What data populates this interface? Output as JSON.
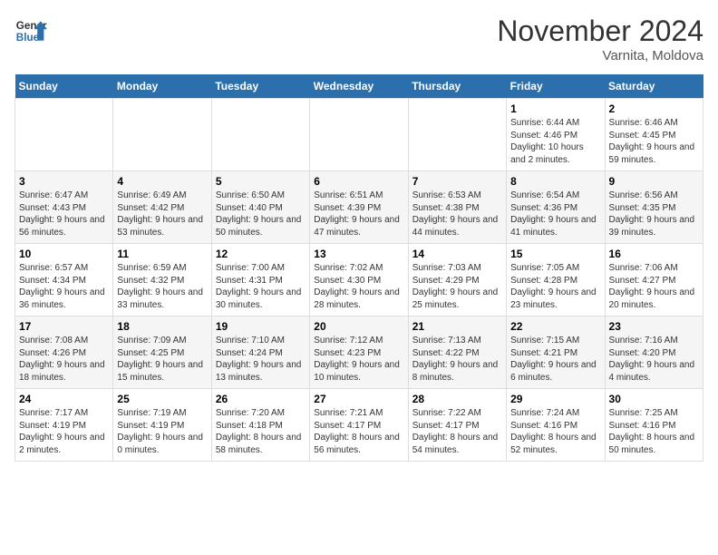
{
  "header": {
    "logo_line1": "General",
    "logo_line2": "Blue",
    "month_title": "November 2024",
    "subtitle": "Varnita, Moldova"
  },
  "days_of_week": [
    "Sunday",
    "Monday",
    "Tuesday",
    "Wednesday",
    "Thursday",
    "Friday",
    "Saturday"
  ],
  "weeks": [
    [
      {
        "day": "",
        "info": ""
      },
      {
        "day": "",
        "info": ""
      },
      {
        "day": "",
        "info": ""
      },
      {
        "day": "",
        "info": ""
      },
      {
        "day": "",
        "info": ""
      },
      {
        "day": "1",
        "info": "Sunrise: 6:44 AM\nSunset: 4:46 PM\nDaylight: 10 hours\nand 2 minutes."
      },
      {
        "day": "2",
        "info": "Sunrise: 6:46 AM\nSunset: 4:45 PM\nDaylight: 9 hours\nand 59 minutes."
      }
    ],
    [
      {
        "day": "3",
        "info": "Sunrise: 6:47 AM\nSunset: 4:43 PM\nDaylight: 9 hours\nand 56 minutes."
      },
      {
        "day": "4",
        "info": "Sunrise: 6:49 AM\nSunset: 4:42 PM\nDaylight: 9 hours\nand 53 minutes."
      },
      {
        "day": "5",
        "info": "Sunrise: 6:50 AM\nSunset: 4:40 PM\nDaylight: 9 hours\nand 50 minutes."
      },
      {
        "day": "6",
        "info": "Sunrise: 6:51 AM\nSunset: 4:39 PM\nDaylight: 9 hours\nand 47 minutes."
      },
      {
        "day": "7",
        "info": "Sunrise: 6:53 AM\nSunset: 4:38 PM\nDaylight: 9 hours\nand 44 minutes."
      },
      {
        "day": "8",
        "info": "Sunrise: 6:54 AM\nSunset: 4:36 PM\nDaylight: 9 hours\nand 41 minutes."
      },
      {
        "day": "9",
        "info": "Sunrise: 6:56 AM\nSunset: 4:35 PM\nDaylight: 9 hours\nand 39 minutes."
      }
    ],
    [
      {
        "day": "10",
        "info": "Sunrise: 6:57 AM\nSunset: 4:34 PM\nDaylight: 9 hours\nand 36 minutes."
      },
      {
        "day": "11",
        "info": "Sunrise: 6:59 AM\nSunset: 4:32 PM\nDaylight: 9 hours\nand 33 minutes."
      },
      {
        "day": "12",
        "info": "Sunrise: 7:00 AM\nSunset: 4:31 PM\nDaylight: 9 hours\nand 30 minutes."
      },
      {
        "day": "13",
        "info": "Sunrise: 7:02 AM\nSunset: 4:30 PM\nDaylight: 9 hours\nand 28 minutes."
      },
      {
        "day": "14",
        "info": "Sunrise: 7:03 AM\nSunset: 4:29 PM\nDaylight: 9 hours\nand 25 minutes."
      },
      {
        "day": "15",
        "info": "Sunrise: 7:05 AM\nSunset: 4:28 PM\nDaylight: 9 hours\nand 23 minutes."
      },
      {
        "day": "16",
        "info": "Sunrise: 7:06 AM\nSunset: 4:27 PM\nDaylight: 9 hours\nand 20 minutes."
      }
    ],
    [
      {
        "day": "17",
        "info": "Sunrise: 7:08 AM\nSunset: 4:26 PM\nDaylight: 9 hours\nand 18 minutes."
      },
      {
        "day": "18",
        "info": "Sunrise: 7:09 AM\nSunset: 4:25 PM\nDaylight: 9 hours\nand 15 minutes."
      },
      {
        "day": "19",
        "info": "Sunrise: 7:10 AM\nSunset: 4:24 PM\nDaylight: 9 hours\nand 13 minutes."
      },
      {
        "day": "20",
        "info": "Sunrise: 7:12 AM\nSunset: 4:23 PM\nDaylight: 9 hours\nand 10 minutes."
      },
      {
        "day": "21",
        "info": "Sunrise: 7:13 AM\nSunset: 4:22 PM\nDaylight: 9 hours\nand 8 minutes."
      },
      {
        "day": "22",
        "info": "Sunrise: 7:15 AM\nSunset: 4:21 PM\nDaylight: 9 hours\nand 6 minutes."
      },
      {
        "day": "23",
        "info": "Sunrise: 7:16 AM\nSunset: 4:20 PM\nDaylight: 9 hours\nand 4 minutes."
      }
    ],
    [
      {
        "day": "24",
        "info": "Sunrise: 7:17 AM\nSunset: 4:19 PM\nDaylight: 9 hours\nand 2 minutes."
      },
      {
        "day": "25",
        "info": "Sunrise: 7:19 AM\nSunset: 4:19 PM\nDaylight: 9 hours\nand 0 minutes."
      },
      {
        "day": "26",
        "info": "Sunrise: 7:20 AM\nSunset: 4:18 PM\nDaylight: 8 hours\nand 58 minutes."
      },
      {
        "day": "27",
        "info": "Sunrise: 7:21 AM\nSunset: 4:17 PM\nDaylight: 8 hours\nand 56 minutes."
      },
      {
        "day": "28",
        "info": "Sunrise: 7:22 AM\nSunset: 4:17 PM\nDaylight: 8 hours\nand 54 minutes."
      },
      {
        "day": "29",
        "info": "Sunrise: 7:24 AM\nSunset: 4:16 PM\nDaylight: 8 hours\nand 52 minutes."
      },
      {
        "day": "30",
        "info": "Sunrise: 7:25 AM\nSunset: 4:16 PM\nDaylight: 8 hours\nand 50 minutes."
      }
    ]
  ]
}
